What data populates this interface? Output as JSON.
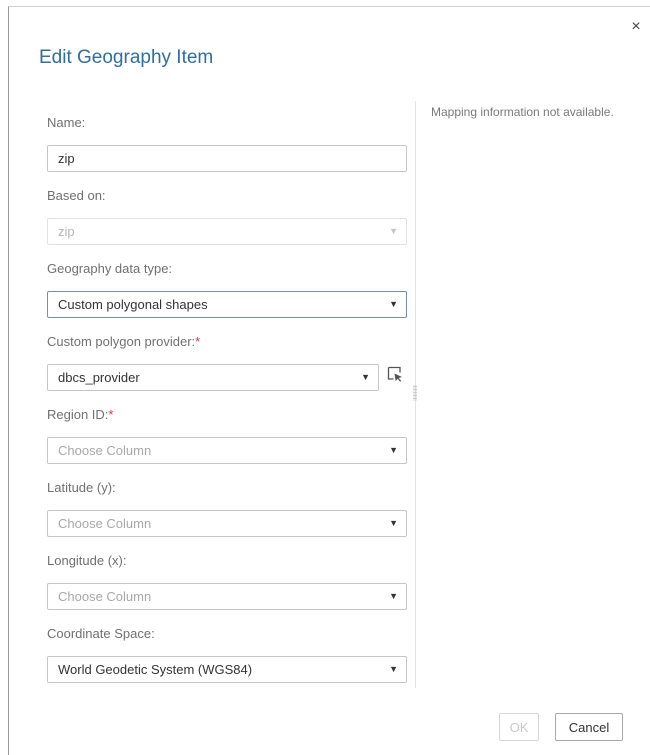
{
  "dialog": {
    "title": "Edit Geography Item",
    "close_label": "×",
    "mapping_info": "Mapping information not available."
  },
  "fields": {
    "name": {
      "label": "Name:",
      "value": "zip"
    },
    "based_on": {
      "label": "Based on:",
      "value": "zip"
    },
    "geo_type": {
      "label": "Geography data type:",
      "value": "Custom polygonal shapes"
    },
    "provider": {
      "label": "Custom polygon provider:",
      "required": "*",
      "value": "dbcs_provider"
    },
    "region_id": {
      "label": "Region ID:",
      "required": "*",
      "placeholder": "Choose Column"
    },
    "latitude": {
      "label": "Latitude (y):",
      "placeholder": "Choose Column"
    },
    "longitude": {
      "label": "Longitude (x):",
      "placeholder": "Choose Column"
    },
    "coordinate": {
      "label": "Coordinate Space:",
      "value": "World Geodetic System (WGS84)"
    }
  },
  "buttons": {
    "ok": "OK",
    "cancel": "Cancel"
  },
  "icons": {
    "dropdown": "▼",
    "close": "close-icon",
    "edit_provider": "edit-cursor-icon"
  }
}
